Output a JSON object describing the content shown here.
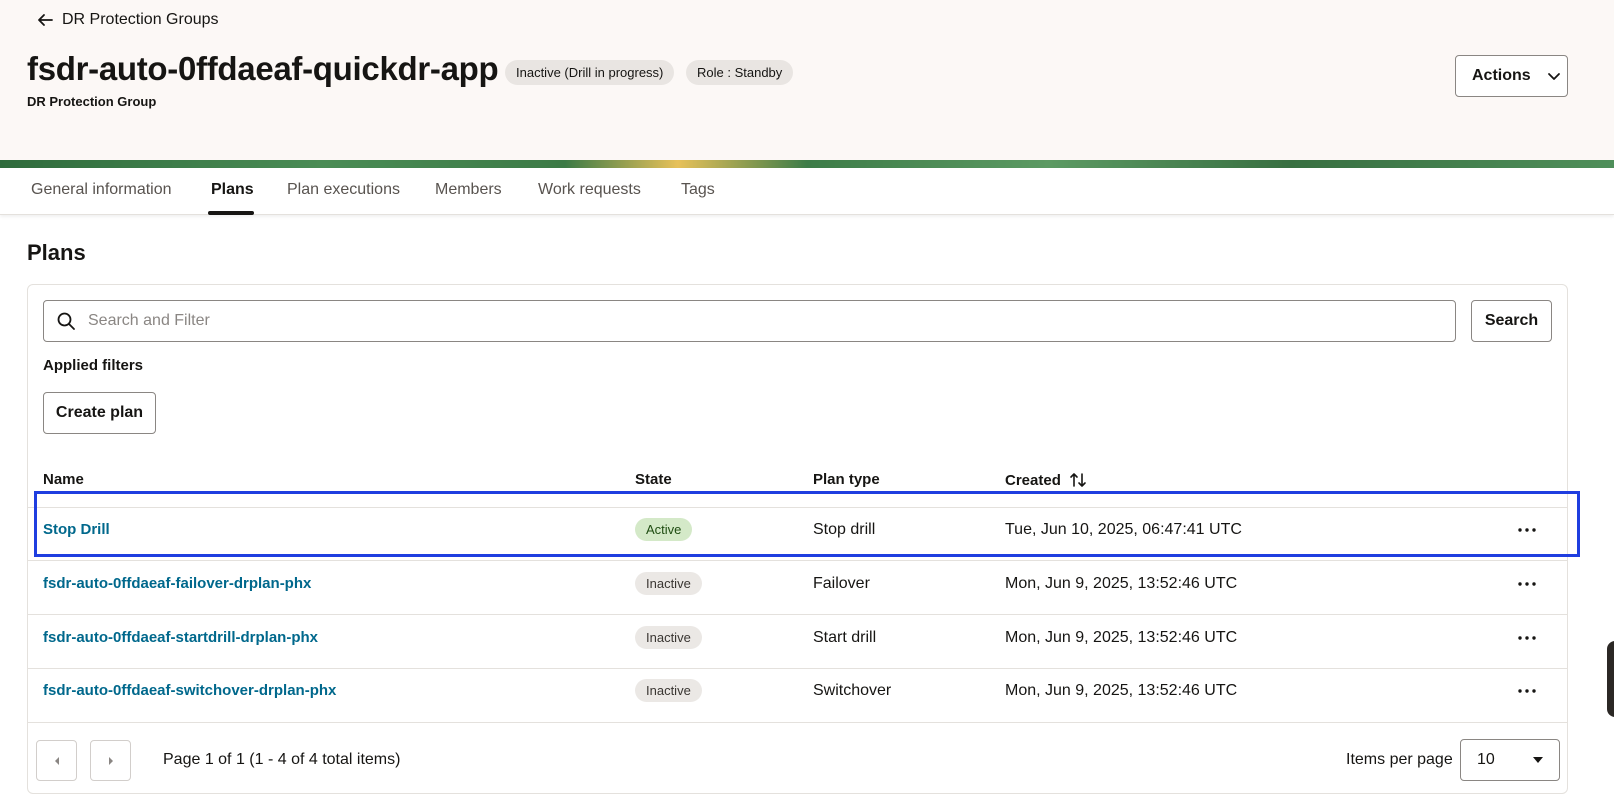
{
  "header": {
    "back_label": "DR Protection Groups",
    "title": "fsdr-auto-0ffdaeaf-quickdr-app",
    "subtitle": "DR Protection Group",
    "badges": [
      "Inactive (Drill in progress)",
      "Role : Standby"
    ],
    "actions_label": "Actions"
  },
  "tabs": [
    {
      "label": "General information",
      "active": false
    },
    {
      "label": "Plans",
      "active": true
    },
    {
      "label": "Plan executions",
      "active": false
    },
    {
      "label": "Members",
      "active": false
    },
    {
      "label": "Work requests",
      "active": false
    },
    {
      "label": "Tags",
      "active": false
    }
  ],
  "plans": {
    "title": "Plans",
    "search_placeholder": "Search and Filter",
    "search_button": "Search",
    "applied_filters_label": "Applied filters",
    "create_button": "Create plan",
    "columns": {
      "name": "Name",
      "state": "State",
      "plan_type": "Plan type",
      "created": "Created"
    },
    "rows": [
      {
        "name": "Stop Drill",
        "state": "Active",
        "plan_type": "Stop drill",
        "created": "Tue, Jun 10, 2025, 06:47:41 UTC"
      },
      {
        "name": "fsdr-auto-0ffdaeaf-failover-drplan-phx",
        "state": "Inactive",
        "plan_type": "Failover",
        "created": "Mon, Jun 9, 2025, 13:52:46 UTC"
      },
      {
        "name": "fsdr-auto-0ffdaeaf-startdrill-drplan-phx",
        "state": "Inactive",
        "plan_type": "Start drill",
        "created": "Mon, Jun 9, 2025, 13:52:46 UTC"
      },
      {
        "name": "fsdr-auto-0ffdaeaf-switchover-drplan-phx",
        "state": "Inactive",
        "plan_type": "Switchover",
        "created": "Mon, Jun 9, 2025, 13:52:46 UTC"
      }
    ]
  },
  "pagination": {
    "summary": "Page 1 of 1 (1 - 4 of 4 total items)",
    "items_per_page_label": "Items per page",
    "items_per_page_value": "10"
  },
  "colors": {
    "link": "#00688c",
    "highlight": "#1f3ee0",
    "active_badge": "#d4e9c8",
    "inactive_badge": "#ebe8e5"
  }
}
